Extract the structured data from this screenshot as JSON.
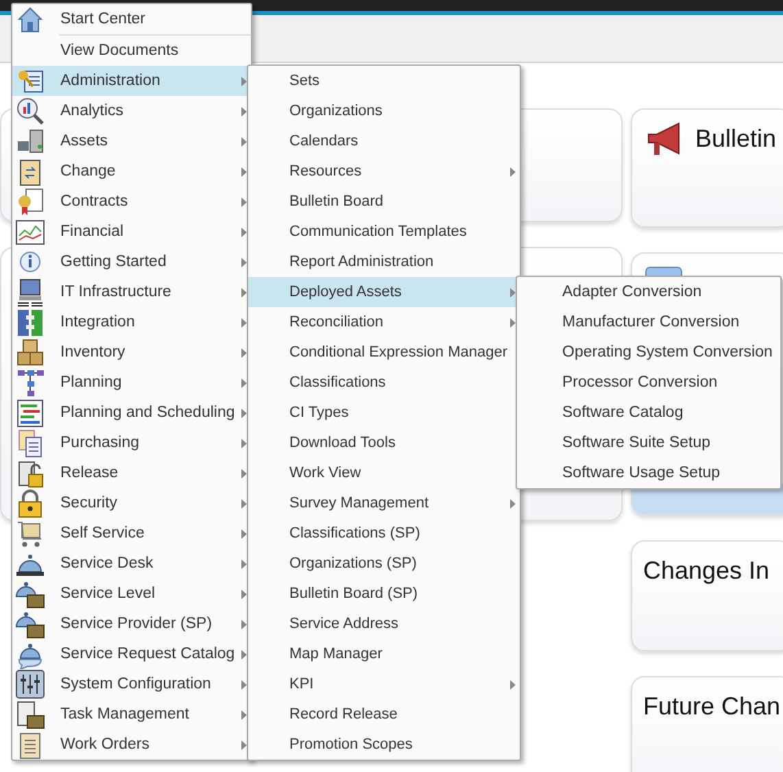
{
  "page": {
    "cards_right": [
      {
        "kind": "bulletin",
        "title": "Bulletin"
      },
      {
        "kind": "inbox"
      },
      {
        "kind": "plain",
        "title": "Changes In"
      },
      {
        "kind": "plain",
        "title": "Future Chan"
      }
    ]
  },
  "main_menu": [
    {
      "label": "Start Center",
      "has_submenu": false,
      "selected": false
    },
    {
      "label": "View Documents",
      "has_submenu": false,
      "selected": false
    },
    {
      "label": "Administration",
      "has_submenu": true,
      "selected": true
    },
    {
      "label": "Analytics",
      "has_submenu": true,
      "selected": false
    },
    {
      "label": "Assets",
      "has_submenu": true,
      "selected": false
    },
    {
      "label": "Change",
      "has_submenu": true,
      "selected": false
    },
    {
      "label": "Contracts",
      "has_submenu": true,
      "selected": false
    },
    {
      "label": "Financial",
      "has_submenu": true,
      "selected": false
    },
    {
      "label": "Getting Started",
      "has_submenu": true,
      "selected": false
    },
    {
      "label": "IT Infrastructure",
      "has_submenu": true,
      "selected": false
    },
    {
      "label": "Integration",
      "has_submenu": true,
      "selected": false
    },
    {
      "label": "Inventory",
      "has_submenu": true,
      "selected": false
    },
    {
      "label": "Planning",
      "has_submenu": true,
      "selected": false
    },
    {
      "label": "Planning and Scheduling",
      "has_submenu": true,
      "selected": false
    },
    {
      "label": "Purchasing",
      "has_submenu": true,
      "selected": false
    },
    {
      "label": "Release",
      "has_submenu": true,
      "selected": false
    },
    {
      "label": "Security",
      "has_submenu": true,
      "selected": false
    },
    {
      "label": "Self Service",
      "has_submenu": true,
      "selected": false
    },
    {
      "label": "Service Desk",
      "has_submenu": true,
      "selected": false
    },
    {
      "label": "Service Level",
      "has_submenu": true,
      "selected": false
    },
    {
      "label": "Service Provider (SP)",
      "has_submenu": true,
      "selected": false
    },
    {
      "label": "Service Request Catalog",
      "has_submenu": true,
      "selected": false
    },
    {
      "label": "System Configuration",
      "has_submenu": true,
      "selected": false
    },
    {
      "label": "Task Management",
      "has_submenu": true,
      "selected": false
    },
    {
      "label": "Work Orders",
      "has_submenu": true,
      "selected": false
    }
  ],
  "submenu": [
    {
      "label": "Sets",
      "has_submenu": false,
      "selected": false
    },
    {
      "label": "Organizations",
      "has_submenu": false,
      "selected": false
    },
    {
      "label": "Calendars",
      "has_submenu": false,
      "selected": false
    },
    {
      "label": "Resources",
      "has_submenu": true,
      "selected": false
    },
    {
      "label": "Bulletin Board",
      "has_submenu": false,
      "selected": false
    },
    {
      "label": "Communication Templates",
      "has_submenu": false,
      "selected": false
    },
    {
      "label": "Report Administration",
      "has_submenu": false,
      "selected": false
    },
    {
      "label": "Deployed Assets",
      "has_submenu": true,
      "selected": true
    },
    {
      "label": "Reconciliation",
      "has_submenu": true,
      "selected": false
    },
    {
      "label": "Conditional Expression Manager",
      "selected": false
    },
    {
      "label": "Classifications",
      "selected": false
    },
    {
      "label": "CI Types",
      "selected": false
    },
    {
      "label": "Download Tools",
      "selected": false
    },
    {
      "label": "Work View",
      "selected": false
    },
    {
      "label": "Survey Management",
      "has_submenu": true,
      "selected": false
    },
    {
      "label": "Classifications (SP)",
      "has_submenu": false,
      "selected": false
    },
    {
      "label": "Organizations (SP)",
      "has_submenu": false,
      "selected": false
    },
    {
      "label": "Bulletin Board (SP)",
      "has_submenu": false,
      "selected": false
    },
    {
      "label": "Service Address",
      "has_submenu": false,
      "selected": false
    },
    {
      "label": "Map Manager",
      "has_submenu": false,
      "selected": false
    },
    {
      "label": "KPI",
      "has_submenu": true,
      "selected": false
    },
    {
      "label": "Record Release",
      "has_submenu": false,
      "selected": false
    },
    {
      "label": "Promotion Scopes",
      "has_submenu": false,
      "selected": false
    }
  ],
  "submenu_2": [
    {
      "label": "Adapter Conversion",
      "selected": false
    },
    {
      "label": "Manufacturer Conversion",
      "selected": false
    },
    {
      "label": "Operating System Conversion",
      "selected": false
    },
    {
      "label": "Processor Conversion",
      "selected": false
    },
    {
      "label": "Software Catalog",
      "selected": false
    },
    {
      "label": "Software Suite Setup",
      "selected": false
    },
    {
      "label": "Software Usage Setup",
      "selected": false
    }
  ]
}
